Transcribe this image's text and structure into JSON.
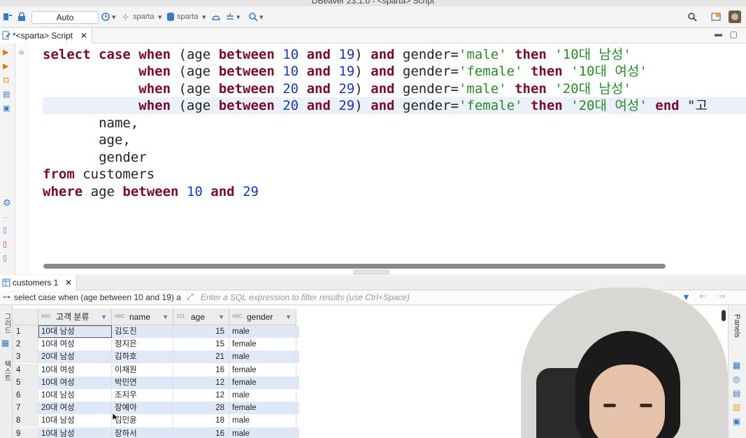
{
  "window": {
    "title": "DBeaver 23.1.0 - <sparta> Script"
  },
  "toolbar": {
    "transaction_mode": "Auto",
    "datasource_label": "sparta",
    "schema_label": "sparta"
  },
  "editor": {
    "tab_label": "*<sparta> Script",
    "lines": [
      [
        [
          "kw",
          "select"
        ],
        [
          "p",
          " "
        ],
        [
          "kw",
          "case"
        ],
        [
          "p",
          " "
        ],
        [
          "kw",
          "when"
        ],
        [
          "p",
          " (age "
        ],
        [
          "kw",
          "between"
        ],
        [
          "p",
          " "
        ],
        [
          "num",
          "10"
        ],
        [
          "p",
          " "
        ],
        [
          "kw",
          "and"
        ],
        [
          "p",
          " "
        ],
        [
          "num",
          "19"
        ],
        [
          "p",
          ") "
        ],
        [
          "kw",
          "and"
        ],
        [
          "p",
          " gender="
        ],
        [
          "str",
          "'male'"
        ],
        [
          "p",
          " "
        ],
        [
          "kw",
          "then"
        ],
        [
          "p",
          " "
        ],
        [
          "str",
          "'10대 남성'"
        ]
      ],
      [
        [
          "p",
          "            "
        ],
        [
          "kw",
          "when"
        ],
        [
          "p",
          " (age "
        ],
        [
          "kw",
          "between"
        ],
        [
          "p",
          " "
        ],
        [
          "num",
          "10"
        ],
        [
          "p",
          " "
        ],
        [
          "kw",
          "and"
        ],
        [
          "p",
          " "
        ],
        [
          "num",
          "19"
        ],
        [
          "p",
          ") "
        ],
        [
          "kw",
          "and"
        ],
        [
          "p",
          " gender="
        ],
        [
          "str",
          "'female'"
        ],
        [
          "p",
          " "
        ],
        [
          "kw",
          "then"
        ],
        [
          "p",
          " "
        ],
        [
          "str",
          "'10대 여성'"
        ]
      ],
      [
        [
          "p",
          "            "
        ],
        [
          "kw",
          "when"
        ],
        [
          "p",
          " (age "
        ],
        [
          "kw",
          "between"
        ],
        [
          "p",
          " "
        ],
        [
          "num",
          "20"
        ],
        [
          "p",
          " "
        ],
        [
          "kw",
          "and"
        ],
        [
          "p",
          " "
        ],
        [
          "num",
          "29"
        ],
        [
          "p",
          ") "
        ],
        [
          "kw",
          "and"
        ],
        [
          "p",
          " gender="
        ],
        [
          "str",
          "'male'"
        ],
        [
          "p",
          " "
        ],
        [
          "kw",
          "then"
        ],
        [
          "p",
          " "
        ],
        [
          "str",
          "'20대 남성'"
        ]
      ],
      [
        [
          "p",
          "            "
        ],
        [
          "kw",
          "when"
        ],
        [
          "p",
          " (age "
        ],
        [
          "kw",
          "between"
        ],
        [
          "p",
          " "
        ],
        [
          "num",
          "20"
        ],
        [
          "p",
          " "
        ],
        [
          "kw",
          "and"
        ],
        [
          "p",
          " "
        ],
        [
          "num",
          "29"
        ],
        [
          "p",
          ") "
        ],
        [
          "kw",
          "and"
        ],
        [
          "p",
          " gender="
        ],
        [
          "str",
          "'female'"
        ],
        [
          "p",
          " "
        ],
        [
          "kw",
          "then"
        ],
        [
          "p",
          " "
        ],
        [
          "str",
          "'20대 여성'"
        ],
        [
          "p",
          " "
        ],
        [
          "kw",
          "end"
        ],
        [
          "p",
          " \"고"
        ]
      ],
      [
        [
          "p",
          "       name,"
        ]
      ],
      [
        [
          "p",
          "       age,"
        ]
      ],
      [
        [
          "p",
          "       gender"
        ]
      ],
      [
        [
          "kw",
          "from"
        ],
        [
          "p",
          " customers"
        ]
      ],
      [
        [
          "kw",
          "where"
        ],
        [
          "p",
          " age "
        ],
        [
          "kw",
          "between"
        ],
        [
          "p",
          " "
        ],
        [
          "num",
          "10"
        ],
        [
          "p",
          " "
        ],
        [
          "kw",
          "and"
        ],
        [
          "p",
          " "
        ],
        [
          "num",
          "29"
        ]
      ]
    ],
    "current_line": 3
  },
  "results": {
    "tab_label": "customers 1",
    "query_preview": "select case when (age between 10 and 19) a",
    "filter_placeholder": "Enter a SQL expression to filter results (use Ctrl+Space)",
    "columns": [
      {
        "type": "ABC",
        "name": "고객 분류"
      },
      {
        "type": "ABC",
        "name": "name"
      },
      {
        "type": "123",
        "name": "age"
      },
      {
        "type": "ABC",
        "name": "gender"
      }
    ],
    "rows": [
      [
        "1",
        "10대 남성",
        "김도진",
        "15",
        "male"
      ],
      [
        "2",
        "10대 여성",
        "정지은",
        "15",
        "female"
      ],
      [
        "3",
        "20대 남성",
        "김하호",
        "21",
        "male"
      ],
      [
        "4",
        "10대 여성",
        "이채원",
        "16",
        "female"
      ],
      [
        "5",
        "10대 여성",
        "박민연",
        "12",
        "female"
      ],
      [
        "6",
        "10대 남성",
        "조지우",
        "12",
        "male"
      ],
      [
        "7",
        "20대 여성",
        "장예아",
        "28",
        "female"
      ],
      [
        "8",
        "10대 남성",
        "김민윤",
        "18",
        "male"
      ],
      [
        "9",
        "10대 남성",
        "장하서",
        "16",
        "male"
      ]
    ],
    "left_tabs": [
      "그리드",
      "텍스트"
    ],
    "right_panel_label": "Panels"
  }
}
